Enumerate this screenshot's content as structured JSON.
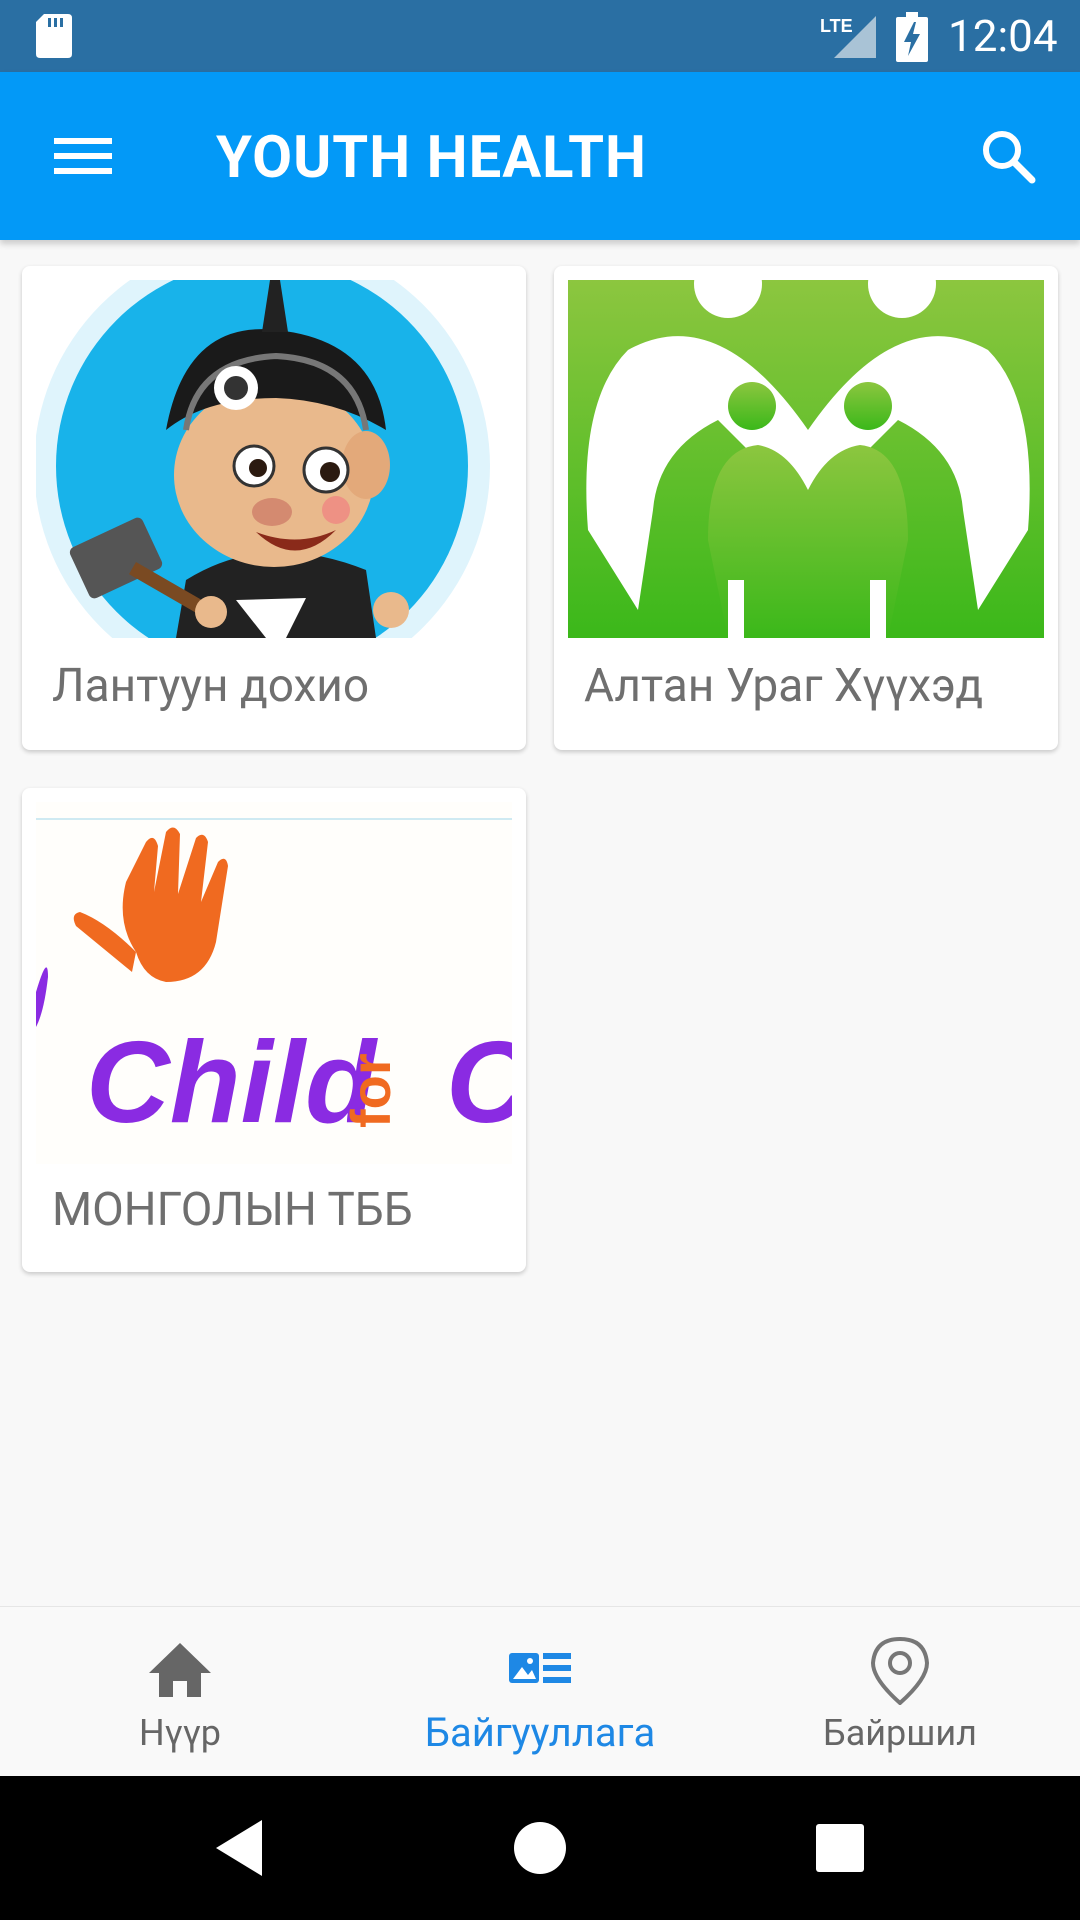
{
  "status_bar": {
    "network": "LTE",
    "time": "12:04"
  },
  "app_bar": {
    "title": "YOUTH HEALTH",
    "menu_icon": "hamburger-menu-icon",
    "search_icon": "search-icon"
  },
  "cards": [
    {
      "label": "Лантуун дохио",
      "image": "cartoon-boy-with-hammer-logo"
    },
    {
      "label": "Алтан Ураг Хүүхэд",
      "image": "family-silhouette-logo"
    },
    {
      "label": "МОНГОЛЫН ТББ",
      "image": "child-for-child-logo",
      "logo_text": "Child for C"
    }
  ],
  "bottom_nav": {
    "items": [
      {
        "label": "Нүүр",
        "icon": "home-icon",
        "active": false
      },
      {
        "label": "Байгууллага",
        "icon": "organizations-icon",
        "active": true
      },
      {
        "label": "Байршил",
        "icon": "location-pin-icon",
        "active": false
      }
    ]
  },
  "colors": {
    "status_bar": "#2a6fa3",
    "app_bar": "#0399f7",
    "active_nav": "#1e88e5",
    "inactive_nav": "#666666",
    "card_label": "#6f6f6f"
  }
}
